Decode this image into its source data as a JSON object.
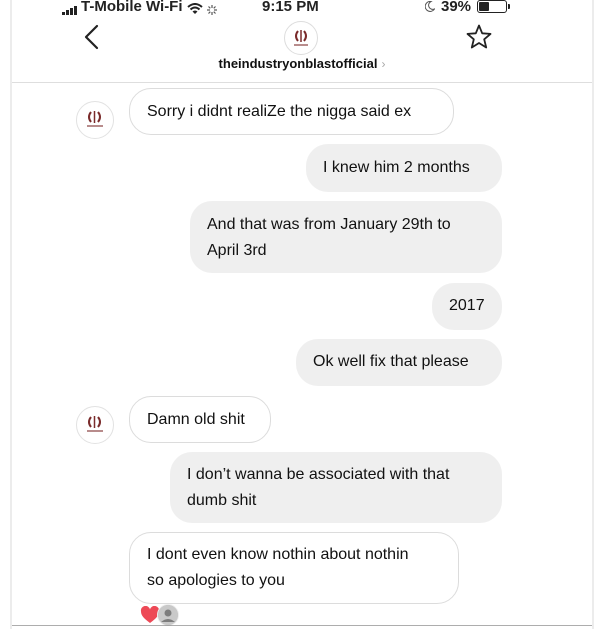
{
  "status_bar": {
    "carrier": "T-Mobile Wi-Fi",
    "time": "9:15 PM",
    "battery": "39%"
  },
  "header": {
    "username": "theindustryonblastofficial"
  },
  "messages": [
    {
      "direction": "incoming",
      "text": "Sorry i didnt realiZe the nigga said ex"
    },
    {
      "direction": "outgoing",
      "text": "I knew him 2 months"
    },
    {
      "direction": "outgoing",
      "text": "And that was from January 29th to\nApril 3rd"
    },
    {
      "direction": "outgoing",
      "text": "2017"
    },
    {
      "direction": "outgoing",
      "text": "Ok well fix that please"
    },
    {
      "direction": "incoming",
      "text": "Damn old shit"
    },
    {
      "direction": "outgoing",
      "text": "I don’t wanna be associated with that\ndumb shit"
    },
    {
      "direction": "incoming",
      "text": "I dont even know nothin about nothin\nso apologies to you"
    }
  ],
  "reaction": {
    "icon": "heart-icon",
    "color": "#ed4956"
  },
  "colors": {
    "outgoing_bubble": "#efefef",
    "incoming_border": "#dcdcdc",
    "heart": "#ed4956"
  }
}
